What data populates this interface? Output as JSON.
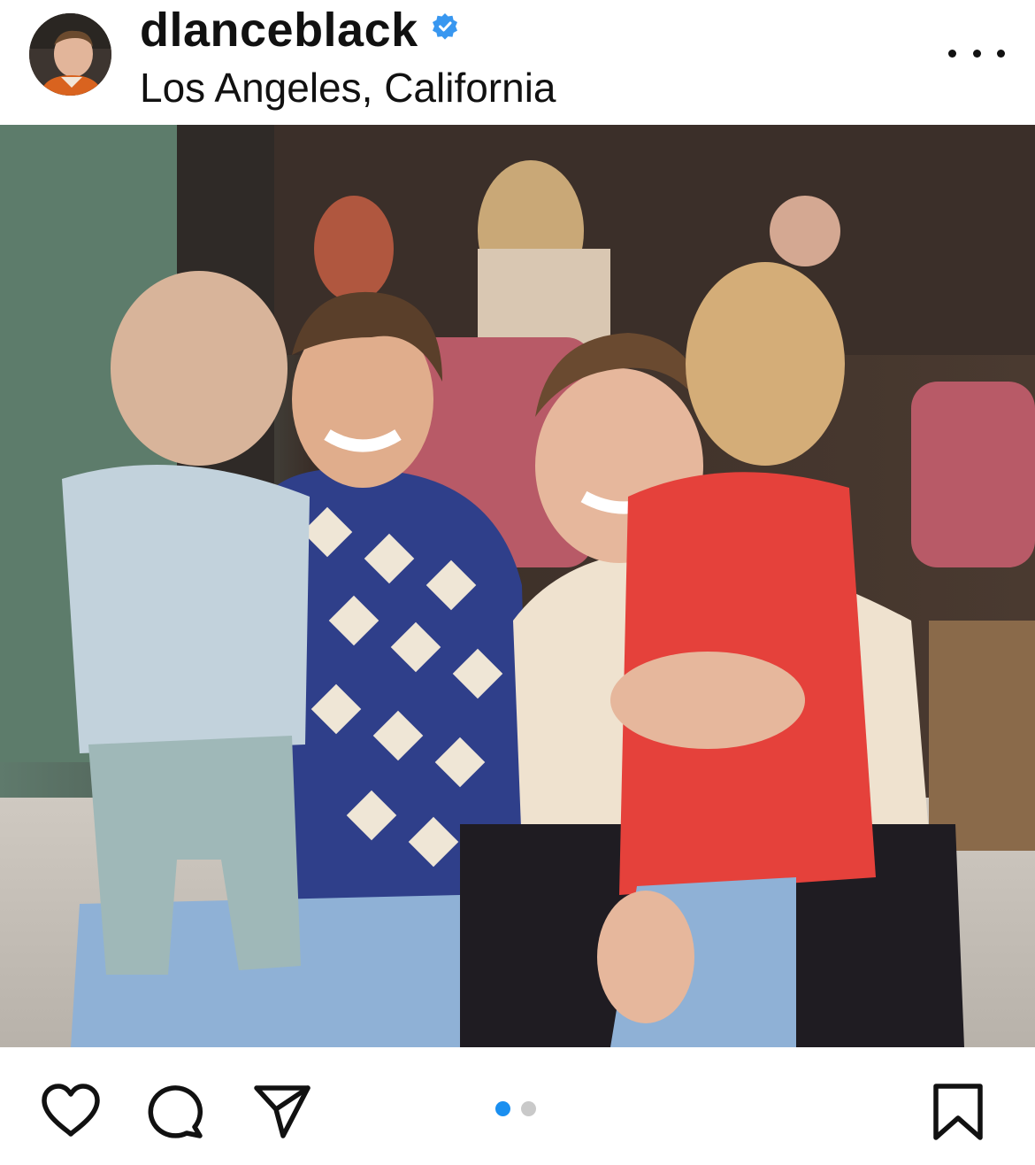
{
  "post": {
    "username": "dlanceblack",
    "verified": true,
    "location": "Los Angeles, California",
    "menu_icon": "more-horizontal-icon",
    "photo_icon": "post-photo",
    "carousel": {
      "total": 2,
      "active_index": 0
    },
    "actions": {
      "like_icon": "heart-icon",
      "comment_icon": "comment-icon",
      "share_icon": "send-icon",
      "save_icon": "bookmark-icon"
    },
    "colors": {
      "verified_badge": "#3897f0",
      "active_dot": "#1a8ff0",
      "inactive_dot": "#c9c9c9",
      "text": "#111111"
    }
  }
}
